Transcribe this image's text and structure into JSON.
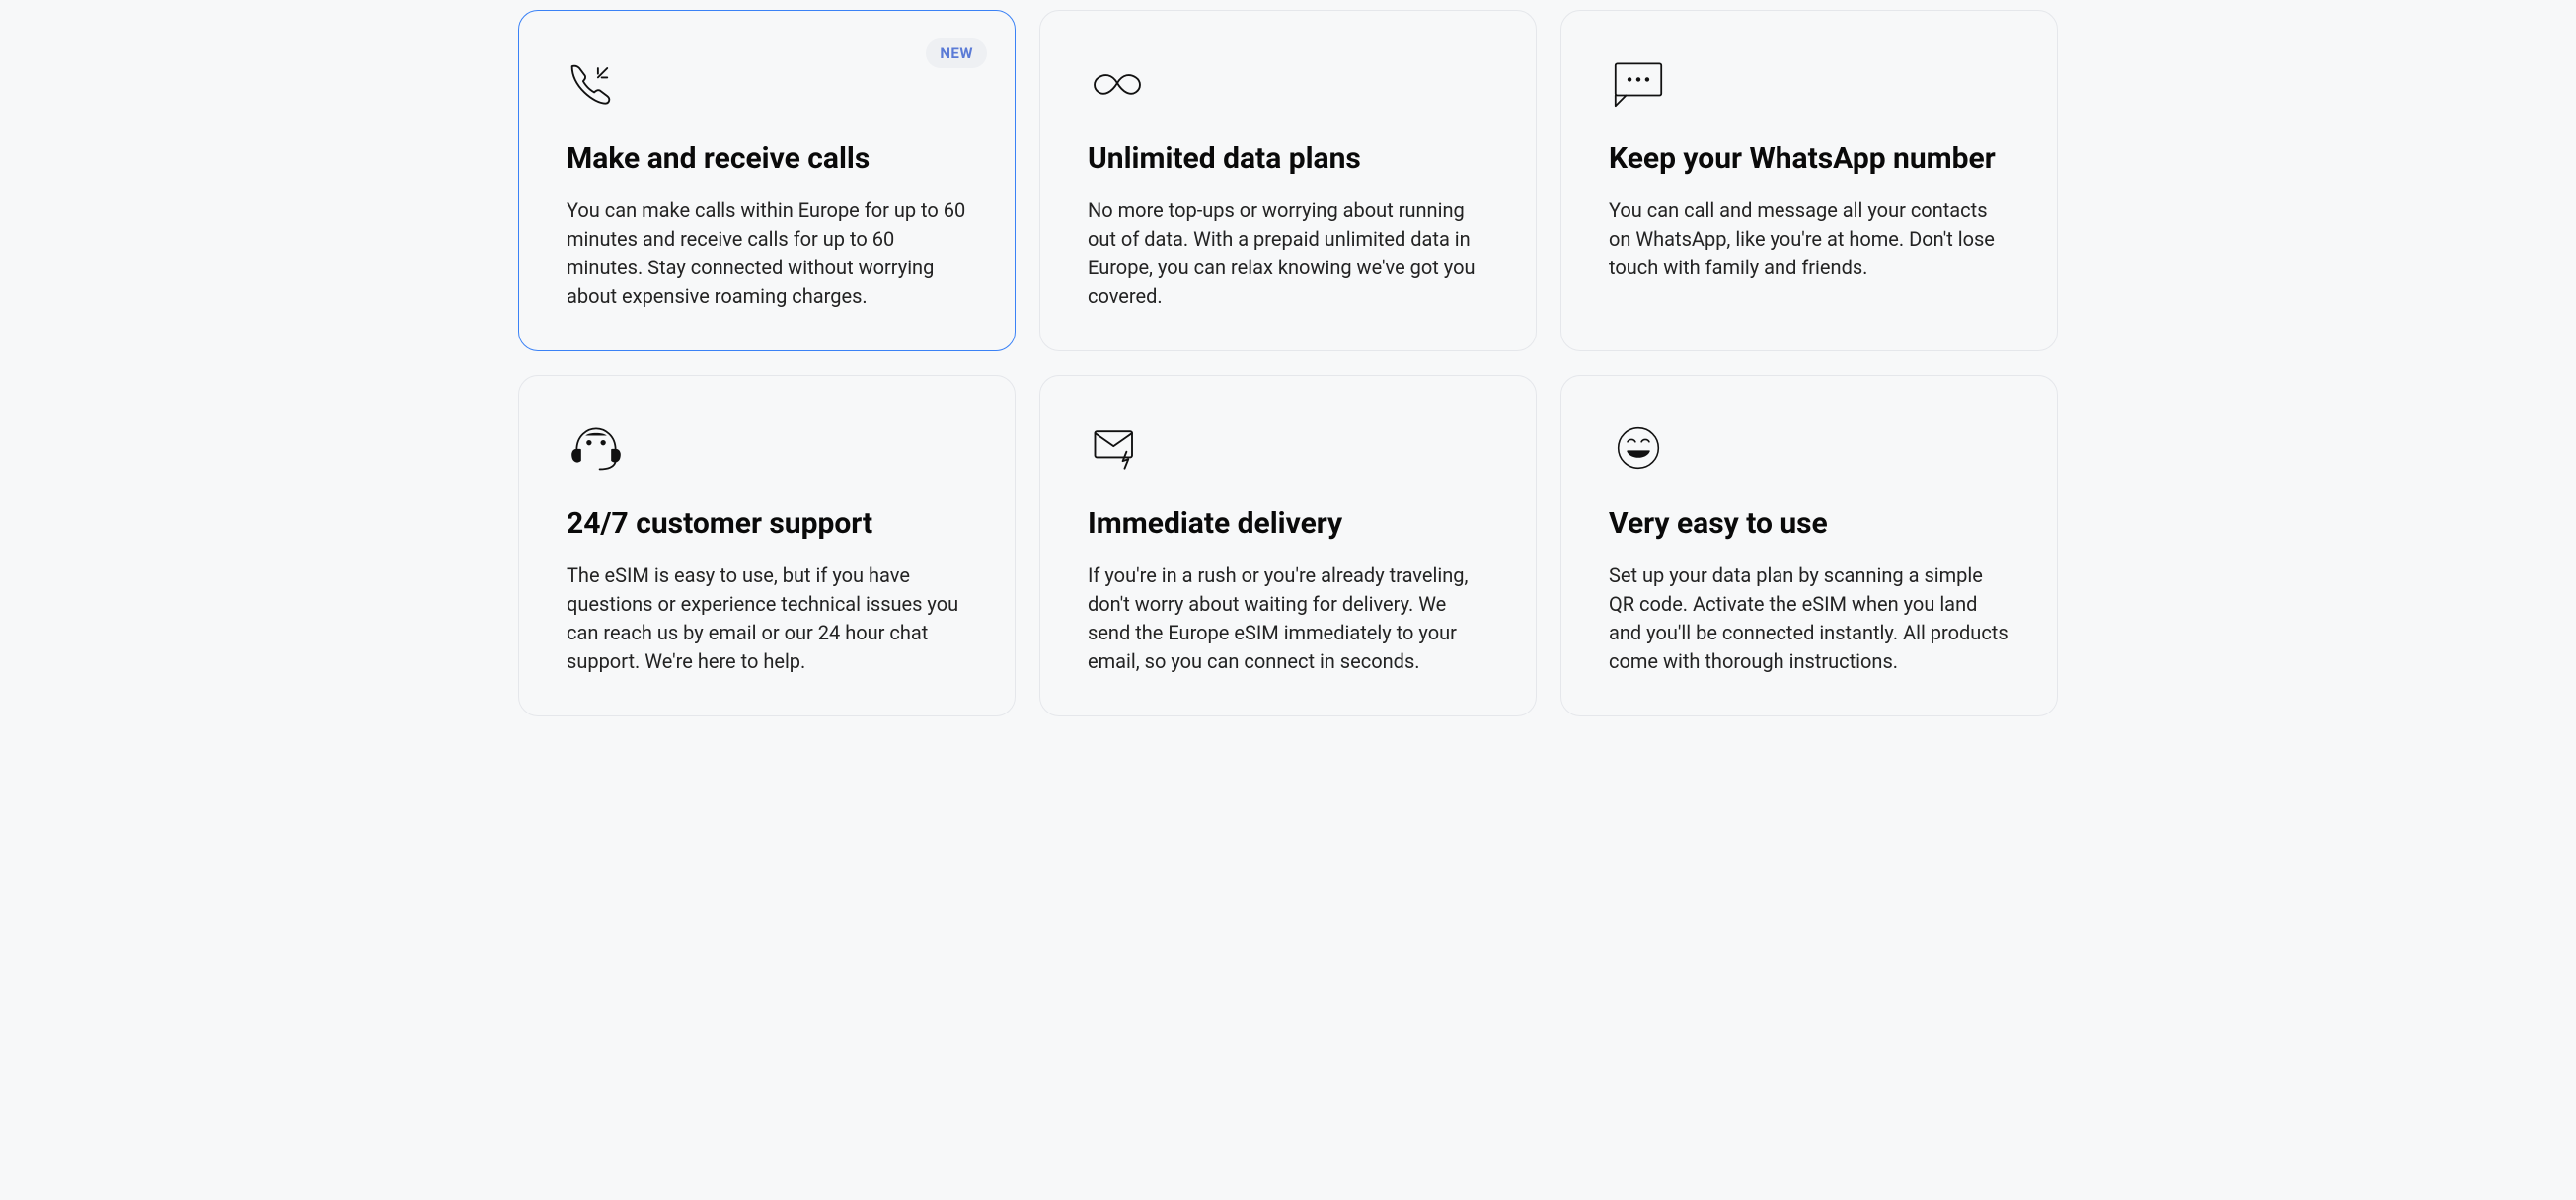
{
  "cards": [
    {
      "badge": "NEW",
      "title": "Make and receive calls",
      "body": "You can make calls within Europe for up to 60 minutes and receive calls for up to 60 minutes. Stay connected without worrying about expensive roaming charges."
    },
    {
      "title": "Unlimited data plans",
      "body": "No more top-ups or worrying about running out of data. With a prepaid unlimited data in Europe, you can relax knowing we've got you covered."
    },
    {
      "title": "Keep your WhatsApp number",
      "body": "You can call and message all your contacts on WhatsApp, like you're at home. Don't lose touch with family and friends."
    },
    {
      "title": "24/7 customer support",
      "body": "The eSIM is easy to use, but if you have questions or experience technical issues you can reach us by email or our 24 hour chat support. We're here to help."
    },
    {
      "title": "Immediate delivery",
      "body": "If you're in a rush or you're already traveling, don't worry about waiting for delivery. We send the Europe eSIM immediately to your email, so you can connect in seconds."
    },
    {
      "title": "Very easy to use",
      "body": "Set up your data plan by scanning a simple QR code. Activate the eSIM when you land and you'll be connected instantly. All products come with thorough instructions."
    }
  ]
}
